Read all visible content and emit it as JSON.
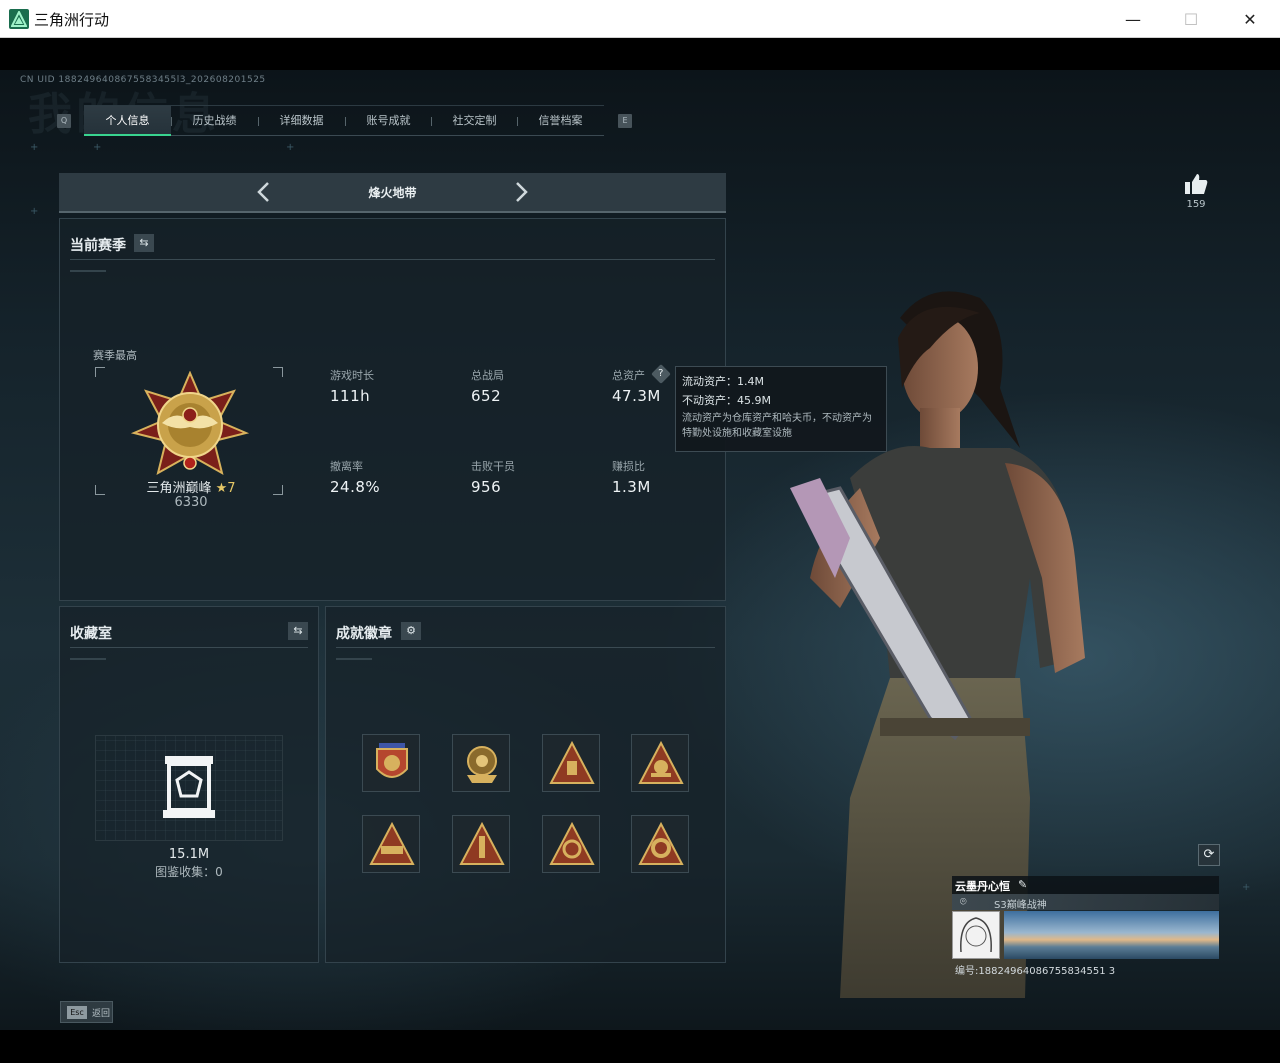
{
  "window": {
    "title": "三角洲行动",
    "minimize": "—",
    "maximize": "☐",
    "close": "✕"
  },
  "header": {
    "uid": "CN UID 1882496408675583455l3_202608201525",
    "bg_title": "我的信息",
    "key_left": "Q",
    "key_right": "E",
    "tabs": [
      "个人信息",
      "历史战绩",
      "详细数据",
      "账号成就",
      "社交定制",
      "信誉档案"
    ],
    "active_tab": 0
  },
  "mode": {
    "name": "烽火地带"
  },
  "season": {
    "heading": "当前赛季",
    "best_label": "赛季最高",
    "rank_name": "三角洲巅峰",
    "rank_stars": "★7",
    "rank_score": "6330",
    "stats": [
      {
        "label": "游戏时长",
        "value": "111h"
      },
      {
        "label": "总战局",
        "value": "652"
      },
      {
        "label": "总资产",
        "value": "47.3M"
      },
      {
        "label": "撤离率",
        "value": "24.8%"
      },
      {
        "label": "击败干员",
        "value": "956"
      },
      {
        "label": "赚损比",
        "value": "1.3M"
      }
    ]
  },
  "tooltip": {
    "liquid": "流动资产：1.4M",
    "fixed": "不动资产：45.9M",
    "desc": "流动资产为仓库资产和哈夫币，不动资产为特勤处设施和收藏室设施"
  },
  "collection": {
    "heading": "收藏室",
    "value": "15.1M",
    "count": "图鉴收集：0"
  },
  "achievements": {
    "heading": "成就徽章",
    "badges": [
      "badge-1",
      "badge-2",
      "badge-3",
      "badge-4",
      "badge-5",
      "badge-6",
      "badge-7",
      "badge-8"
    ]
  },
  "likes": {
    "count": "159"
  },
  "player_card": {
    "name": "云墨丹心恒",
    "title": "S3巅峰战神",
    "id": "编号:18824964086755834551 3"
  },
  "footer": {
    "esc_key": "Esc",
    "esc_label": "返回"
  },
  "colors": {
    "accent": "#39d48f",
    "panel": "#162128",
    "gold": "#c9a24a"
  }
}
